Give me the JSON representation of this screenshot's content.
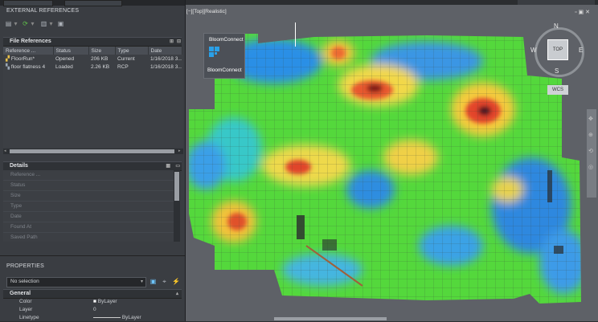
{
  "external_references": {
    "title": "EXTERNAL REFERENCES",
    "file_references_title": "File References",
    "columns": [
      "Reference ...",
      "Status",
      "Size",
      "Type",
      "Date"
    ],
    "rows": [
      {
        "name": "FloorRun*",
        "status": "Opened",
        "size": "206 KB",
        "type": "Current",
        "date": "1/16/2018 3..."
      },
      {
        "name": "floor flatness 4",
        "status": "Loaded",
        "size": "2.26 KB",
        "type": "RCP",
        "date": "1/16/2018 3..."
      }
    ]
  },
  "details": {
    "title": "Details",
    "fields": [
      "Reference ...",
      "Status",
      "Size",
      "Type",
      "Date",
      "Found At",
      "Saved Path"
    ]
  },
  "properties": {
    "title": "PROPERTIES",
    "selection": "No selection",
    "group": "General",
    "rows": [
      {
        "label": "Color",
        "value": "ByLayer"
      },
      {
        "label": "Layer",
        "value": "0"
      },
      {
        "label": "Linetype",
        "value": "ByLayer"
      }
    ]
  },
  "viewport": {
    "label": "[−][Top][Realistic]",
    "popup_title": "BloomConnect",
    "popup_label": "BloomConnect",
    "viewcube": {
      "north": "N",
      "west": "W",
      "east": "E",
      "south": "S",
      "face": "TOP",
      "wcs": "WCS"
    }
  },
  "colors": {
    "accent_blue": "#2aa0e8",
    "heat_red": "#d9261c",
    "heat_yellow": "#f4e04a",
    "heat_green": "#4fdc3a",
    "heat_blue": "#3a8fe0"
  }
}
